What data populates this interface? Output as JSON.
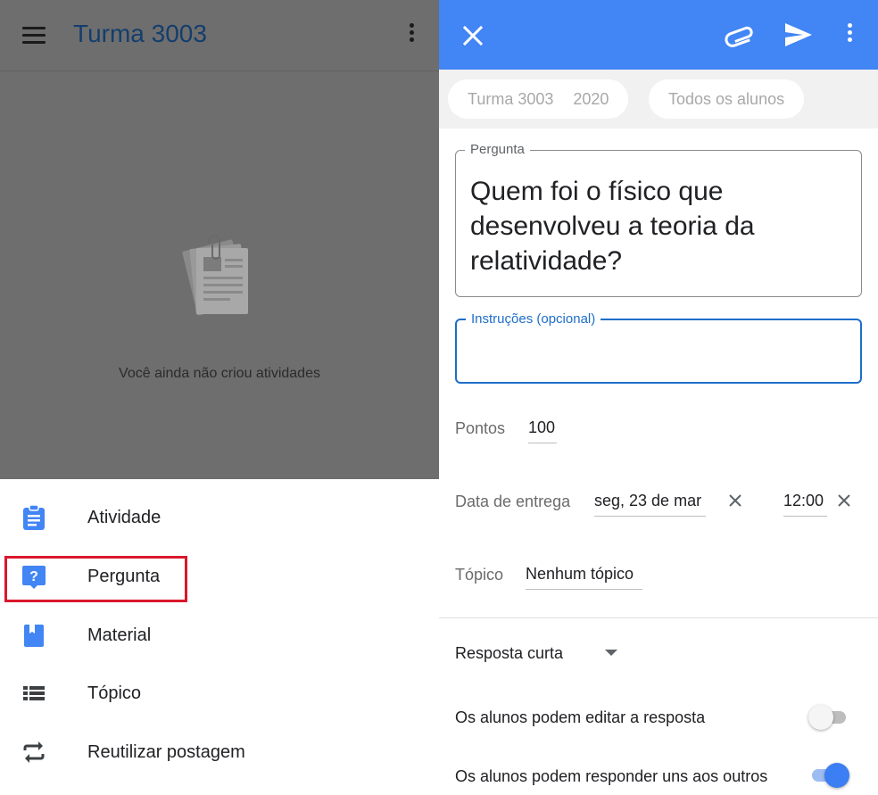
{
  "left_panel": {
    "title": "Turma 3003",
    "empty_message": "Você ainda não criou atividades",
    "menu": [
      {
        "label": "Atividade",
        "icon": "assignment-icon"
      },
      {
        "label": "Pergunta",
        "icon": "question-icon"
      },
      {
        "label": "Material",
        "icon": "material-book-icon"
      },
      {
        "label": "Tópico",
        "icon": "topic-list-icon"
      },
      {
        "label": "Reutilizar postagem",
        "icon": "reuse-repeat-icon"
      }
    ]
  },
  "right_panel": {
    "chips": {
      "class_name": "Turma 3003",
      "class_year": "2020",
      "audience": "Todos os alunos"
    },
    "question": {
      "legend": "Pergunta",
      "text": "Quem foi o físico que desenvolveu a teoria da relatividade?"
    },
    "instructions": {
      "legend": "Instruções (opcional)",
      "value": ""
    },
    "points": {
      "label": "Pontos",
      "value": "100"
    },
    "due": {
      "label": "Data de entrega",
      "date": "seg, 23 de mar",
      "time": "12:00"
    },
    "topic": {
      "label": "Tópico",
      "value": "Nenhum tópico"
    },
    "answer_type": {
      "selected": "Resposta curta"
    },
    "toggles": [
      {
        "label": "Os alunos podem editar a resposta",
        "on": false
      },
      {
        "label": "Os alunos podem responder uns aos outros",
        "on": true
      }
    ]
  },
  "colors": {
    "accent_blue": "#4285f4",
    "highlight_red": "#d9182c",
    "title_blue": "#143e6d",
    "field_focus_blue": "#1e6ec9"
  }
}
